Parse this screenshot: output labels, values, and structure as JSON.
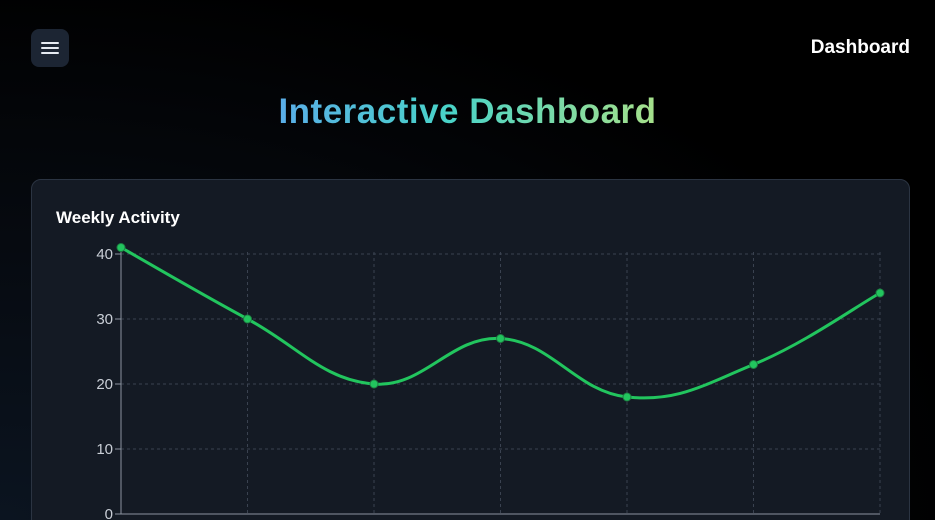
{
  "header": {
    "menu_icon": "hamburger-menu-icon",
    "nav_title": "Dashboard"
  },
  "page": {
    "title": "Interactive Dashboard",
    "title_gradient": [
      "#5aaee8",
      "#49d3c8",
      "#a6e08a"
    ]
  },
  "card": {
    "title": "Weekly Activity"
  },
  "chart_data": {
    "type": "line",
    "title": "Weekly Activity",
    "xlabel": "",
    "ylabel": "",
    "x": [
      0,
      1,
      2,
      3,
      4,
      5,
      6
    ],
    "series": [
      {
        "values": [
          41,
          30,
          20,
          27,
          18,
          23,
          34
        ],
        "color": "#22c55e"
      }
    ],
    "ylim": [
      0,
      42
    ],
    "yticks": [
      "0",
      "10",
      "20",
      "30",
      "40"
    ],
    "grid": true,
    "grid_style": "dashed",
    "smooth": true
  }
}
